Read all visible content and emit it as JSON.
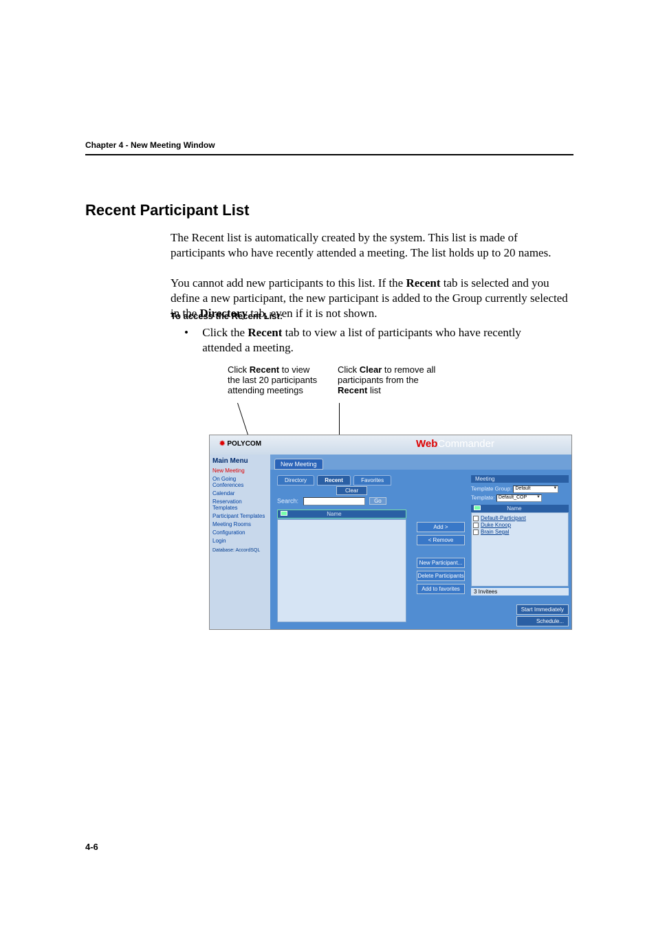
{
  "header": {
    "chapter": "Chapter 4 - New Meeting Window"
  },
  "section": {
    "title": "Recent Participant List"
  },
  "paragraphs": {
    "p1": "The Recent list is automatically created by the system. This list is made of participants who have recently attended a meeting. The list holds up to 20 names.",
    "p2_pre": "You cannot add new participants to this list. If the ",
    "p2_b1": "Recent",
    "p2_mid": " tab is selected and you define a new participant, the new participant is added to the Group currently selected in the ",
    "p2_b2": "Directory",
    "p2_post": " tab, even if it is not shown."
  },
  "subhead": "To access the Recent List:",
  "bullet": {
    "pre": "Click the ",
    "b1": "Recent",
    "post": " tab to view a list of participants who have recently attended a meeting."
  },
  "annotations": {
    "left_l1_pre": "Click ",
    "left_l1_b": "Recent",
    "left_l1_post": " to view",
    "left_l2": "the last 20 participants",
    "left_l3": "attending meetings",
    "right_l1_pre": "Click ",
    "right_l1_b": "Clear",
    "right_l1_post": " to remove all",
    "right_l2": "participants from the",
    "right_l3_b": "Recent",
    "right_l3_post": " list"
  },
  "page_number": "4-6",
  "shot": {
    "brand_left": "POLYCOM",
    "brand_web": "Web",
    "brand_cmd": "Commander",
    "sidebar": {
      "title": "Main Menu",
      "items": [
        "New Meeting",
        "On Going Conferences",
        "Calendar",
        "Reservation Templates",
        "Participant Templates",
        "Meeting Rooms",
        "Configuration",
        "Login"
      ],
      "database": "Database: AccordSQL"
    },
    "newmeeting_tab": "New Meeting",
    "tabs": {
      "directory": "Directory",
      "recent": "Recent",
      "favorites": "Favorites"
    },
    "clear_btn": "Clear",
    "search_label": "Search:",
    "go_btn": "Go",
    "list_head": "Name",
    "mid_buttons": {
      "add": "Add >",
      "remove": "< Remove",
      "new_part": "New Participant...",
      "del_part": "Delete Participants",
      "add_fav": "Add to favorites"
    },
    "right": {
      "head": "Meeting",
      "tmpl_group": "Template Group:",
      "tmpl_group_val": "Default",
      "tmpl": "Template:",
      "tmpl_val": "Default_COP",
      "list_head": "Name",
      "items": [
        "Default-Participant",
        "Duke Knoop",
        "Brain Segal"
      ],
      "invitees": "3 Invitees"
    },
    "bottom": {
      "start": "Start Immediately",
      "schedule": "Schedule..."
    }
  }
}
